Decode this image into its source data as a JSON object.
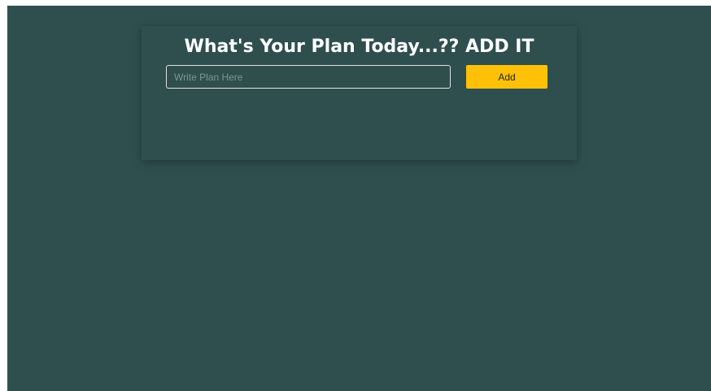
{
  "colors": {
    "background": "#2f4f4f",
    "accent": "#ffc107",
    "title_text": "#ffffff"
  },
  "card": {
    "title": "What's Your Plan Today...?? ADD IT",
    "input": {
      "placeholder": "Write Plan Here",
      "value": ""
    },
    "add_label": "Add"
  }
}
